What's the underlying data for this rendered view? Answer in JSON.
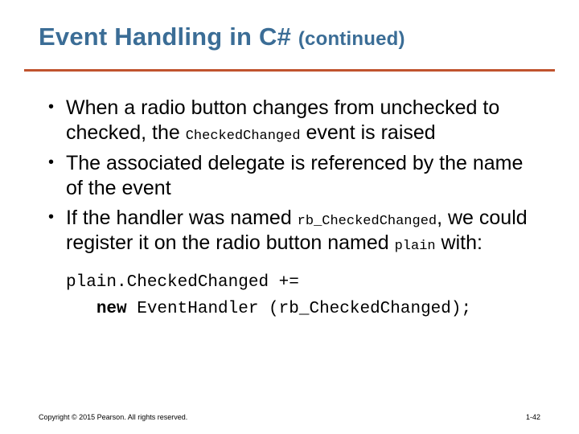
{
  "title": {
    "main": "Event Handling in C# ",
    "cont": "(continued)"
  },
  "bullets": {
    "b1a": "When a radio button changes from unchecked to checked, the ",
    "b1code": "CheckedChanged",
    "b1b": " event is raised",
    "b2": "The associated delegate is referenced by the name of the event",
    "b3a": "If the handler was named ",
    "b3code1": "rb_CheckedChanged",
    "b3b": ", we could register it on the radio button named ",
    "b3code2": "plain",
    "b3c": " with:"
  },
  "code": {
    "line1": "plain.CheckedChanged +=",
    "line2_indent": "   ",
    "line2_kw": "new",
    "line2_rest": " EventHandler (rb_CheckedChanged);"
  },
  "footer": {
    "copyright": "Copyright © 2015 Pearson. All rights reserved.",
    "page": "1-42"
  }
}
